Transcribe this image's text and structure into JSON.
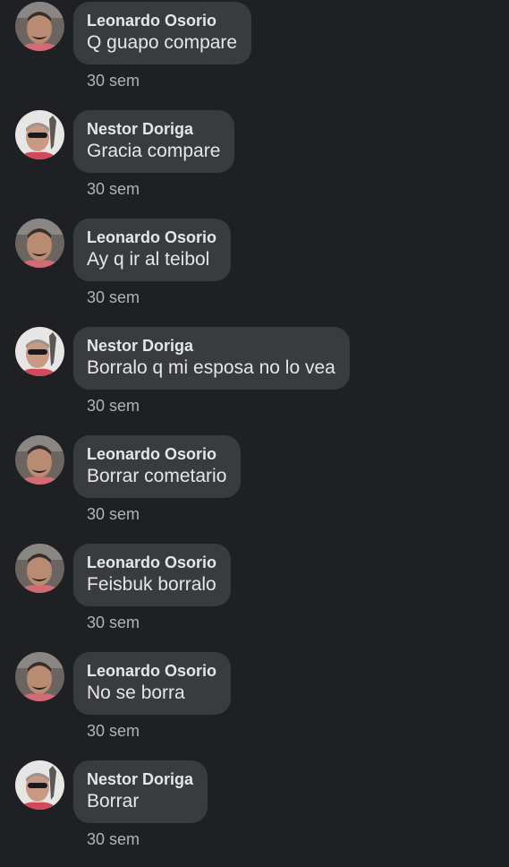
{
  "comments": [
    {
      "author": "Leonardo Osorio",
      "text": "Q guapo compare",
      "time": "30 sem",
      "avatar": "leonardo-avatar"
    },
    {
      "author": "Nestor Doriga",
      "text": "Gracia compare",
      "time": "30 sem",
      "avatar": "nestor-avatar"
    },
    {
      "author": "Leonardo Osorio",
      "text": "Ay q ir al teibol",
      "time": "30 sem",
      "avatar": "leonardo-avatar"
    },
    {
      "author": "Nestor Doriga",
      "text": "Borralo q mi esposa no lo vea",
      "time": "30 sem",
      "avatar": "nestor-avatar"
    },
    {
      "author": "Leonardo Osorio",
      "text": "Borrar cometario",
      "time": "30 sem",
      "avatar": "leonardo-avatar"
    },
    {
      "author": "Leonardo Osorio",
      "text": "Feisbuk borralo",
      "time": "30 sem",
      "avatar": "leonardo-avatar"
    },
    {
      "author": "Leonardo Osorio",
      "text": "No se borra",
      "time": "30 sem",
      "avatar": "leonardo-avatar"
    },
    {
      "author": "Nestor Doriga",
      "text": "Borrar",
      "time": "30 sem",
      "avatar": "nestor-avatar"
    }
  ]
}
